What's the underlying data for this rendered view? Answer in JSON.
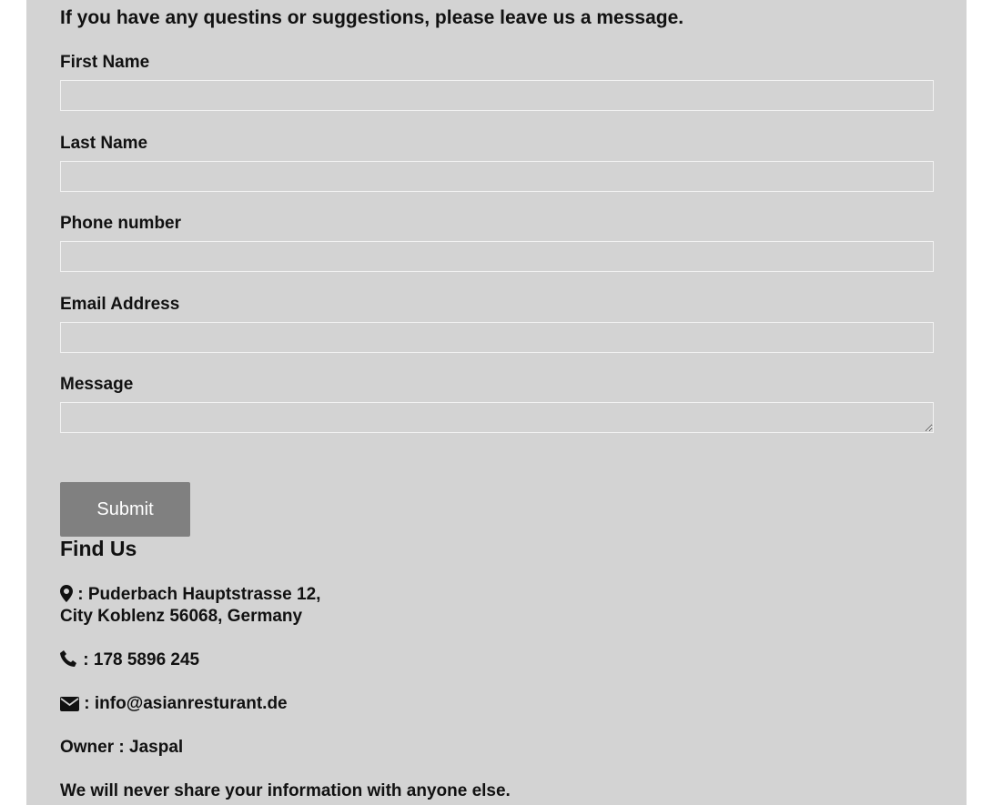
{
  "form": {
    "intro": "If you have any questins or suggestions, please leave us a message.",
    "fields": [
      {
        "label": "First Name",
        "value": "",
        "placeholder": ""
      },
      {
        "label": "Last Name",
        "value": "",
        "placeholder": ""
      },
      {
        "label": "Phone number",
        "value": "",
        "placeholder": ""
      },
      {
        "label": "Email Address",
        "value": "",
        "placeholder": ""
      },
      {
        "label": "Message",
        "value": "",
        "placeholder": ""
      }
    ],
    "submit_label": "Submit"
  },
  "find_us": {
    "title": "Find Us",
    "address_line1": ": Puderbach Hauptstrasse 12,",
    "address_line2": "City Koblenz 56068, Germany",
    "phone": ": 178 5896 245",
    "email": ": info@asianresturant.de",
    "owner": "Owner : Jaspal",
    "privacy_note": "We will never share your information with anyone else.",
    "icons": [
      "map-marker-icon",
      "phone-icon",
      "envelope-icon"
    ]
  },
  "colors": {
    "panel_bg": "#d3d3d3",
    "button_bg": "#808080",
    "input_border": "#f2f2f2",
    "text": "#111111"
  }
}
